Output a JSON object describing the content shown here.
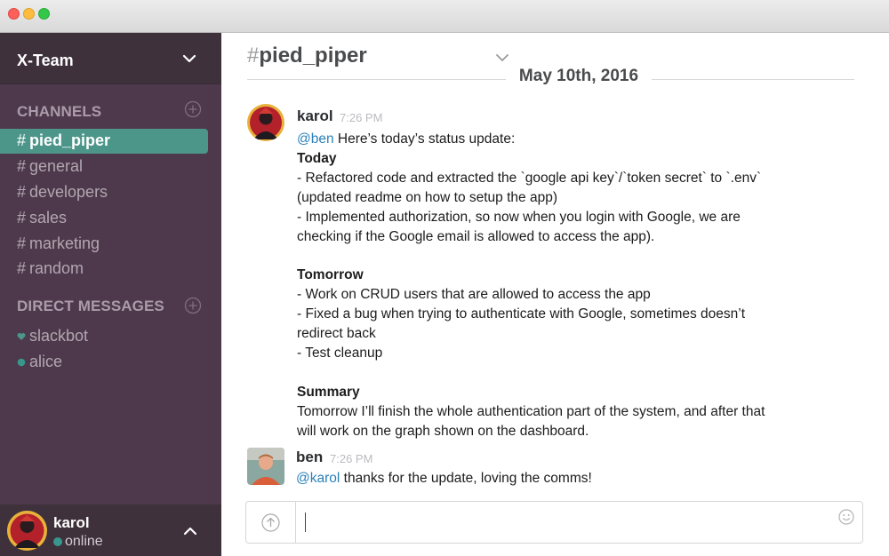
{
  "window": {
    "controls": [
      "close",
      "minimize",
      "zoom"
    ]
  },
  "sidebar": {
    "team_name": "X-Team",
    "channels_title": "CHANNELS",
    "channels": [
      {
        "hash": "#",
        "name": "pied_piper",
        "active": true
      },
      {
        "hash": "#",
        "name": "general",
        "active": false
      },
      {
        "hash": "#",
        "name": "developers",
        "active": false
      },
      {
        "hash": "#",
        "name": "sales",
        "active": false
      },
      {
        "hash": "#",
        "name": "marketing",
        "active": false
      },
      {
        "hash": "#",
        "name": "random",
        "active": false
      }
    ],
    "dm_title": "DIRECT MESSAGES",
    "direct_messages": [
      {
        "name": "slackbot",
        "presence_icon": "heart-icon"
      },
      {
        "name": "alice",
        "presence_icon": "online-dot-icon"
      }
    ],
    "current_user": {
      "name": "karol",
      "status": "online"
    }
  },
  "main": {
    "channel_hash": "#",
    "channel_name": "pied_piper",
    "date_divider": "May 10th, 2016",
    "messages": [
      {
        "author": "karol",
        "time": "7:26 PM",
        "mention": "@ben",
        "lines": [
          "Here’s today’s status update:",
          "Today",
          "- Refactored code and extracted the `google api key`/`token secret` to `.env`",
          "(updated readme on how to setup the app)",
          "- Implemented authorization, so now when you login with Google, we are",
          "checking if the Google email is allowed to access the app).",
          "Tomorrow",
          "- Work on CRUD users that are allowed to access the app",
          "- Fixed a bug when trying to authenticate with Google, sometimes doesn’t",
          "redirect back",
          "- Test cleanup",
          "Summary",
          "Tomorrow I’ll finish the whole authentication part of the system, and after that",
          "will work on the graph shown on the dashboard."
        ]
      },
      {
        "author": "ben",
        "time": "7:26 PM",
        "mention": "@karol",
        "text": "thanks for the update, loving the comms!"
      }
    ],
    "composer": {
      "placeholder": "",
      "value": ""
    }
  },
  "colors": {
    "sidebar_bg": "#4d394b",
    "sidebar_header_bg": "#3e313c",
    "active_channel": "#4c9689",
    "mention": "#2a80b9",
    "presence": "#38978d"
  }
}
